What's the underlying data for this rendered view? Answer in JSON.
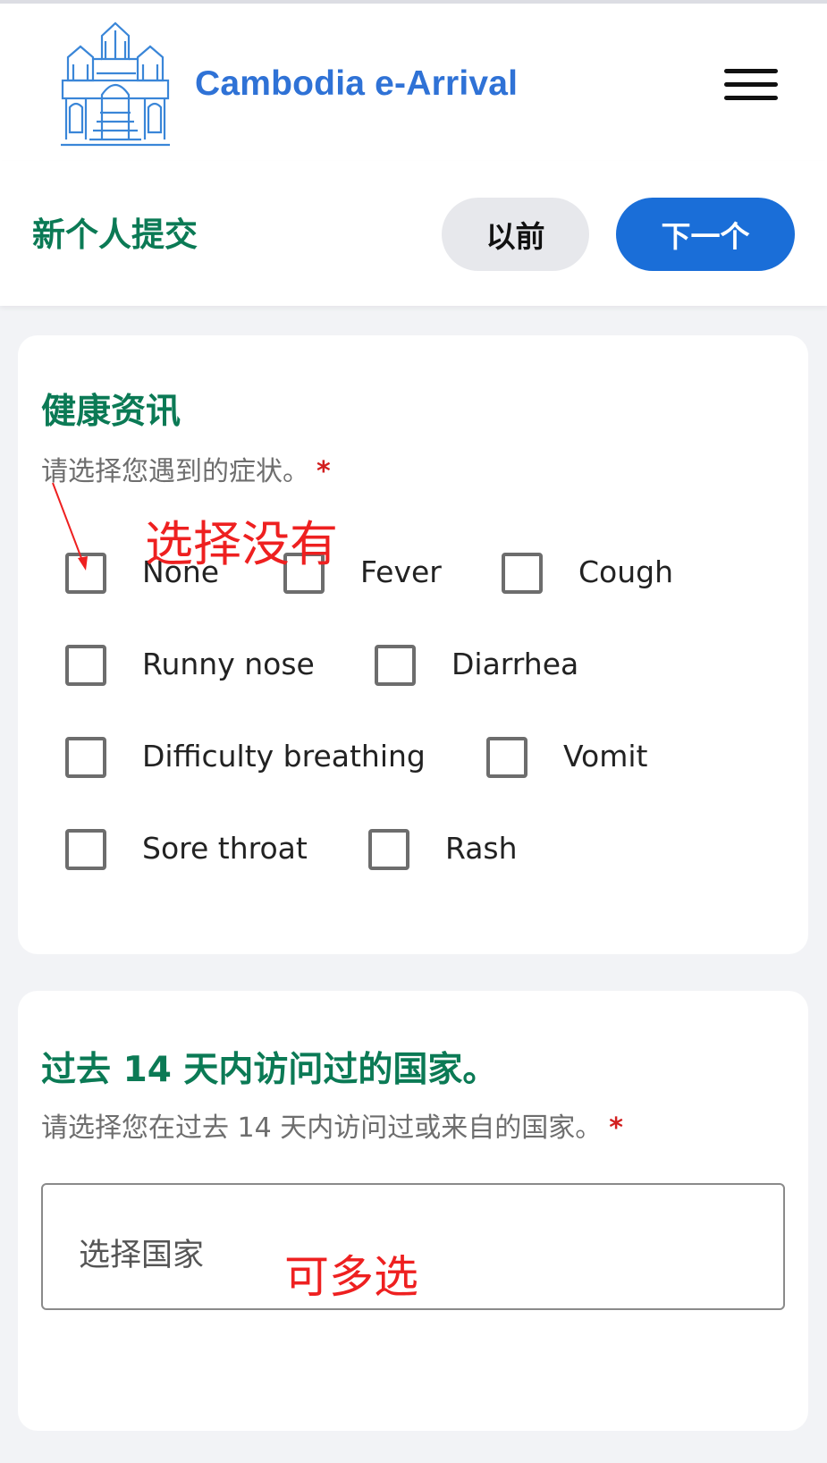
{
  "header": {
    "app_title": "Cambodia e-Arrival",
    "logo_icon": "angkor-temple-logo-icon",
    "menu_icon": "hamburger-menu-icon"
  },
  "subbar": {
    "title": "新个人提交",
    "prev_label": "以前",
    "next_label": "下一个"
  },
  "health": {
    "title": "健康资讯",
    "subtitle": "请选择您遇到的症状。",
    "required_mark": "*",
    "options": [
      {
        "label": "None",
        "checked": false
      },
      {
        "label": "Fever",
        "checked": false
      },
      {
        "label": "Cough",
        "checked": false
      },
      {
        "label": "Runny nose",
        "checked": false
      },
      {
        "label": "Diarrhea",
        "checked": false
      },
      {
        "label": "Difficulty breathing",
        "checked": false
      },
      {
        "label": "Vomit",
        "checked": false
      },
      {
        "label": "Sore throat",
        "checked": false
      },
      {
        "label": "Rash",
        "checked": false
      }
    ]
  },
  "countries": {
    "title": "过去 14 天内访问过的国家。",
    "subtitle": "请选择您在过去 14 天内访问过或来自的国家。",
    "required_mark": "*",
    "placeholder": "选择国家"
  },
  "annotations": {
    "select_none": "选择没有",
    "multi_select": "可多选",
    "color": "#ee2020"
  },
  "colors": {
    "brand_blue": "#2f72d6",
    "primary_button": "#1a6ed8",
    "section_green": "#0b7a55",
    "required_red": "#d21f1f"
  }
}
